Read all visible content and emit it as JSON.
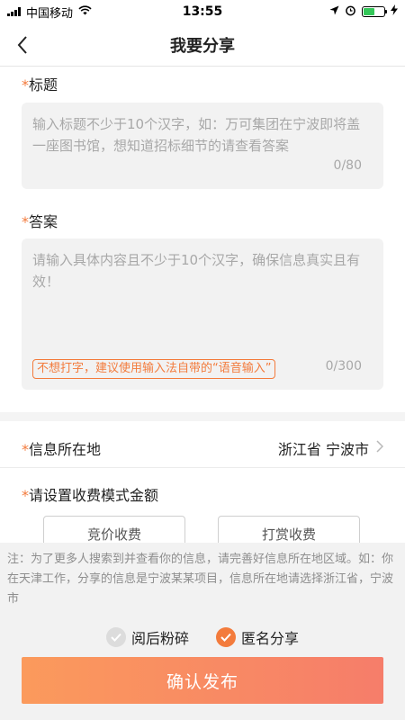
{
  "status_bar": {
    "carrier": "中国移动",
    "time": "13:55"
  },
  "nav": {
    "back_icon": "‹",
    "title": "我要分享"
  },
  "form": {
    "required_mark": "*",
    "title_label": "标题",
    "title_placeholder": "输入标题不少于10个汉字，如：万可集团在宁波即将盖一座图书馆，想知道招标细节的请查看答案",
    "title_counter": "0/80",
    "answer_label": "答案",
    "answer_placeholder": "请输入具体内容且不少于10个汉字，确保信息真实且有效！",
    "voice_hint": "不想打字，建议使用输入法自带的“语音输入”",
    "answer_counter": "0/300",
    "location_label": "信息所在地",
    "location_value": "浙江省 宁波市",
    "fee_label": "请设置收费模式金额",
    "fee_options": [
      "竞价收费",
      "打赏收费"
    ]
  },
  "bottom": {
    "note": "注：为了更多人搜索到并查看你的信息，请完善好信息所在地区域。如：你在天津工作，分享的信息是宁波某某项目，信息所在地请选择浙江省，宁波市",
    "option_burn": "阅后粉碎",
    "option_anonymous": "匿名分享",
    "burn_checked": false,
    "anonymous_checked": true,
    "confirm_label": "确认发布"
  },
  "colors": {
    "accent": "#f37b3c",
    "button_gradient_start": "#fb9a5c",
    "button_gradient_end": "#f67d6a"
  }
}
